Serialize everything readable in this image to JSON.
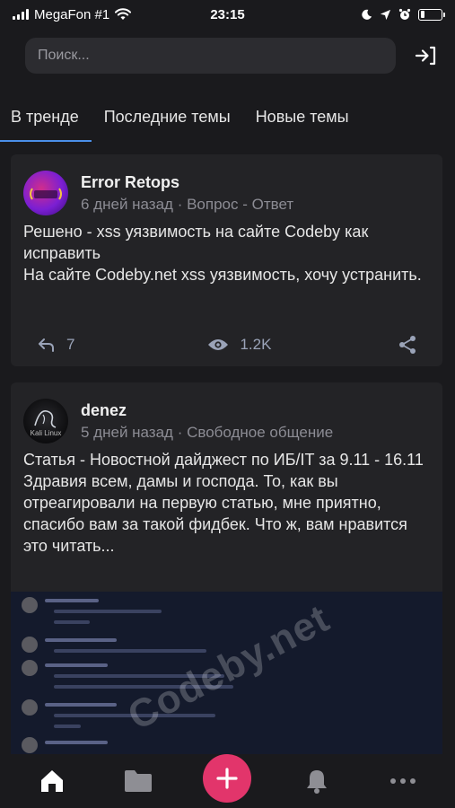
{
  "status_bar": {
    "carrier": "MegaFon #1",
    "time": "23:15"
  },
  "search": {
    "placeholder": "Поиск..."
  },
  "tabs": [
    {
      "label": "В тренде",
      "active": true
    },
    {
      "label": "Последние темы",
      "active": false
    },
    {
      "label": "Новые темы",
      "active": false
    }
  ],
  "posts": [
    {
      "author": "Error Retops",
      "meta": "6 дней назад · Вопрос - Ответ",
      "body_line1": "Решено - xss уязвимость на сайте Codeby как исправить",
      "body_line2": "На сайте Codeby.net xss уязвимость, хочу устранить.",
      "replies": "7",
      "views": "1.2K"
    },
    {
      "author": "denez",
      "meta": "5 дней назад · Свободное общение",
      "body_line1": "Статья - Новостной дайджест по ИБ/IT за 9.11 - 16.11",
      "body_line2": "Здравия всем, дамы и господа. То, как вы отреагировали на первую статью, мне приятно, спасибо вам за такой фидбек. Что ж, вам нравится это читать...",
      "avatar_text": "Kali Linux",
      "watermark": "Codeby.net"
    }
  ],
  "colors": {
    "accent": "#4a8fe8",
    "fab": "#e2356b",
    "background": "#1a1a1d",
    "card": "#232326"
  }
}
